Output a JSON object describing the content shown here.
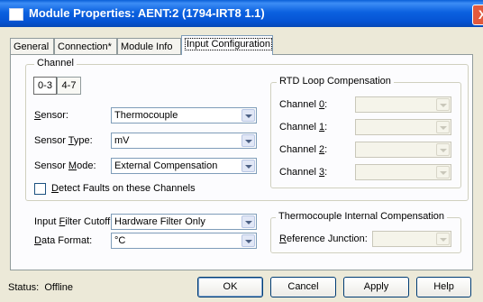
{
  "window": {
    "title": "Module Properties: AENT:2 (1794-IRT8 1.1)",
    "close": "X"
  },
  "tabs": [
    {
      "label": "General"
    },
    {
      "label": "Connection*"
    },
    {
      "label": "Module Info"
    },
    {
      "label": "Input Configuration"
    }
  ],
  "channel": {
    "legend": "Channel",
    "buttons": [
      "0-3",
      "4-7"
    ],
    "sensor": {
      "label_pre": "",
      "label_key": "S",
      "label_post": "ensor:",
      "value": "Thermocouple"
    },
    "sensor_type": {
      "label_pre": "Sensor ",
      "label_key": "T",
      "label_post": "ype:",
      "value": "mV"
    },
    "sensor_mode": {
      "label_pre": "Sensor ",
      "label_key": "M",
      "label_post": "ode:",
      "value": "External Compensation"
    },
    "detect_faults": {
      "label_pre": "",
      "label_key": "D",
      "label_post": "etect Faults on these Channels",
      "checked": false
    }
  },
  "rtd": {
    "legend": "RTD Loop Compensation",
    "channels": [
      {
        "pre": "Channel ",
        "key": "0",
        "post": ":"
      },
      {
        "pre": "Channel ",
        "key": "1",
        "post": ":"
      },
      {
        "pre": "Channel ",
        "key": "2",
        "post": ":"
      },
      {
        "pre": "Channel ",
        "key": "3",
        "post": ":"
      }
    ]
  },
  "input_filter": {
    "label_pre": "Input ",
    "label_key": "F",
    "label_post": "ilter Cutoff:",
    "value": "Hardware Filter Only"
  },
  "data_format": {
    "label_pre": "",
    "label_key": "D",
    "label_post": "ata Format:",
    "value": "°C"
  },
  "tc_comp": {
    "legend": "Thermocouple Internal Compensation",
    "ref_label_pre": "",
    "ref_label_key": "R",
    "ref_label_post": "eference Junction:"
  },
  "status": {
    "label": "Status:",
    "value": "Offline"
  },
  "buttons": {
    "ok": "OK",
    "cancel": "Cancel",
    "apply": "Apply",
    "help": "Help"
  }
}
